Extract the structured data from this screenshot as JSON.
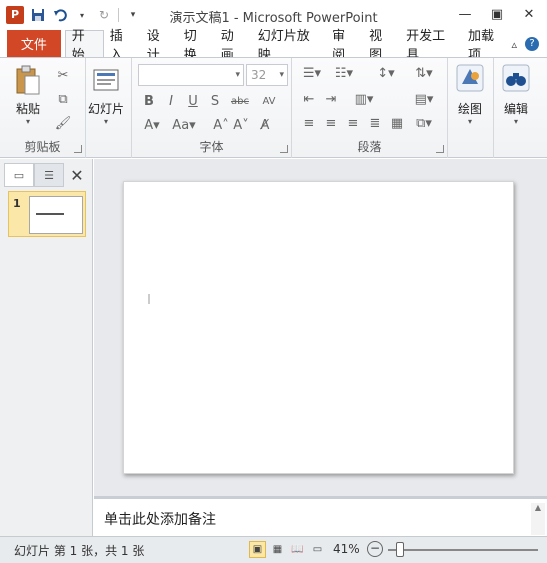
{
  "window": {
    "title": "演示文稿1 - Microsoft PowerPoint",
    "app_logo": "P"
  },
  "qat": {
    "save_icon": "save-icon",
    "undo_icon": "undo-icon",
    "redo_icon": "redo-icon",
    "customize_icon": "dropdown-icon"
  },
  "tabs": {
    "file": "文件",
    "items": [
      "开始",
      "插入",
      "设计",
      "切换",
      "动画",
      "幻灯片放映",
      "审阅",
      "视图",
      "开发工具",
      "加载项"
    ],
    "active_index": 0
  },
  "ribbon": {
    "clipboard": {
      "label": "剪贴板",
      "paste": "粘贴"
    },
    "slides": {
      "new_slide": "幻灯片"
    },
    "font": {
      "label": "字体",
      "font_name": "",
      "font_size": "32"
    },
    "paragraph": {
      "label": "段落"
    },
    "drawing": {
      "label": "绘图"
    },
    "editing": {
      "label": "编辑"
    }
  },
  "left_pane": {
    "slide_number": "1"
  },
  "notes": {
    "placeholder": "单击此处添加备注"
  },
  "status": {
    "slide_info": "幻灯片 第 1 张，共 1 张",
    "zoom": "41%",
    "zoom_level": 0.41
  },
  "colors": {
    "file_tab": "#d24726",
    "thumb_selected": "#fbe7a8"
  }
}
